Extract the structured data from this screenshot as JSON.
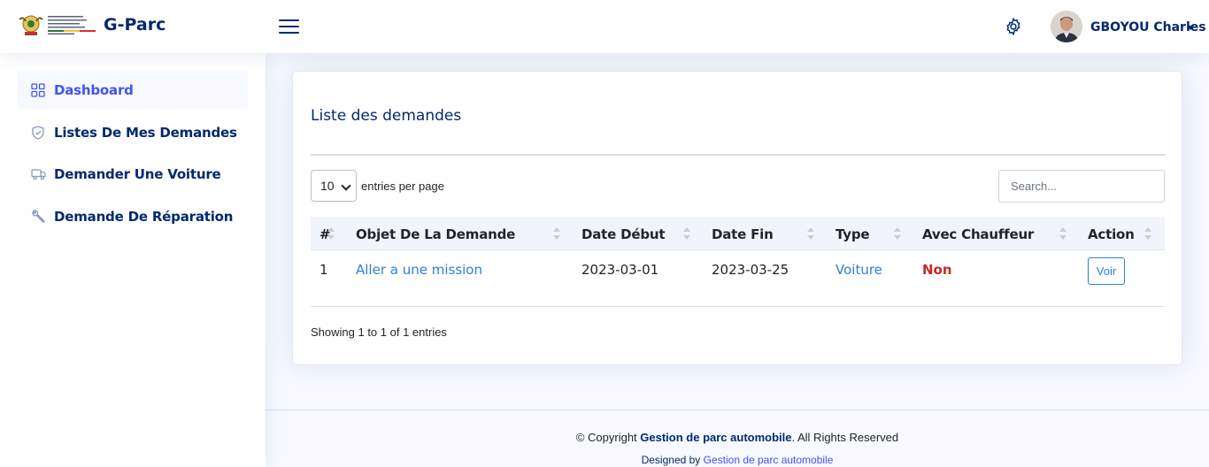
{
  "header": {
    "brand": "G-Parc",
    "user_name": "GBOYOU Charles",
    "icons": {
      "menu": "menu-icon",
      "settings": "gear-icon",
      "caret": "caret-down-icon"
    }
  },
  "sidebar": {
    "items": [
      {
        "label": "Dashboard",
        "icon": "grid-icon",
        "active": true
      },
      {
        "label": "Listes De Mes Demandes",
        "icon": "shield-icon",
        "active": false
      },
      {
        "label": "Demander Une Voiture",
        "icon": "truck-icon",
        "active": false
      },
      {
        "label": "Demande De Réparation",
        "icon": "wrench-icon",
        "active": false
      }
    ]
  },
  "card": {
    "title": "Liste des demandes",
    "per_page_value": "10",
    "per_page_label": "entries per page",
    "search_placeholder": "Search...",
    "columns": [
      "#",
      "Objet De La Demande",
      "Date Début",
      "Date Fin",
      "Type",
      "Avec Chauffeur",
      "Action"
    ],
    "rows": [
      {
        "index": "1",
        "objet": "Aller a une mission",
        "date_debut": "2023-03-01",
        "date_fin": "2023-03-25",
        "type": "Voiture",
        "chauffeur": "Non",
        "action": "Voir"
      }
    ],
    "showing": "Showing 1 to 1 of 1 entries"
  },
  "footer": {
    "copyright_prefix": "© Copyright ",
    "copyright_name": "Gestion de parc automobile",
    "copyright_suffix": ". All Rights Reserved",
    "designed_by": "Designed by ",
    "designed_link": "Gestion de parc automobile"
  },
  "colors": {
    "navy": "#012970",
    "accent": "#4154f1",
    "link": "#2f7fd8",
    "danger": "#c62828",
    "page_bg": "#f6f9ff"
  }
}
